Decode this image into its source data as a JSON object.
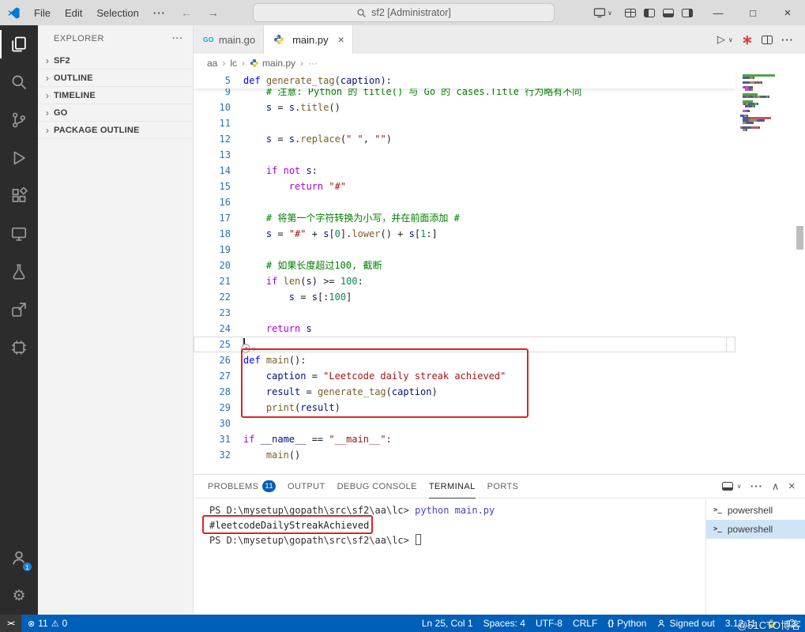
{
  "watermark": "@51CTO博客",
  "titlebar": {
    "menus": [
      "File",
      "Edit",
      "Selection"
    ],
    "more": "···",
    "back": "←",
    "forward": "→",
    "search_text": "sf2 [Administrator]",
    "chevron": "∨",
    "window": {
      "minimize": "—",
      "maximize": "□",
      "close": "×"
    }
  },
  "activity_bar": {
    "account_badge": "1",
    "gear": "⚙"
  },
  "sidebar": {
    "title": "EXPLORER",
    "more": "···",
    "chevron": "›",
    "sections": [
      "SF2",
      "OUTLINE",
      "TIMELINE",
      "GO",
      "PACKAGE OUTLINE"
    ]
  },
  "tabs": {
    "tab1": {
      "label": "main.go",
      "icon_text": "GO"
    },
    "tab2": {
      "label": "main.py",
      "close": "×"
    },
    "actions": {
      "run": "▷",
      "run_chevron": "∨",
      "runner": "∗",
      "more": "···"
    }
  },
  "breadcrumb": {
    "sep": "›",
    "items": [
      "aa",
      "lc",
      "main.py"
    ],
    "more": "···"
  },
  "editor": {
    "cursor_line": 25,
    "hint_chevron": "∨",
    "sticky": {
      "num": 5,
      "ind": 0,
      "tk": [
        [
          "k",
          "def"
        ],
        [
          "o",
          " "
        ],
        [
          "f",
          "generate_tag"
        ],
        [
          "o",
          "("
        ],
        [
          "v",
          "caption"
        ],
        [
          "o",
          "):"
        ]
      ]
    },
    "lines": [
      {
        "num": 9,
        "ind": 4,
        "tk": [
          [
            "c",
            "# 注意: Python 的 title() 与 Go 的 cases.Title 行为略有不同"
          ]
        ]
      },
      {
        "num": 10,
        "ind": 4,
        "tk": [
          [
            "v",
            "s"
          ],
          [
            "o",
            " = "
          ],
          [
            "v",
            "s"
          ],
          [
            "o",
            "."
          ],
          [
            "f",
            "title"
          ],
          [
            "o",
            "()"
          ]
        ]
      },
      {
        "num": 11,
        "ind": 0,
        "tk": []
      },
      {
        "num": 12,
        "ind": 4,
        "tk": [
          [
            "v",
            "s"
          ],
          [
            "o",
            " = "
          ],
          [
            "v",
            "s"
          ],
          [
            "o",
            "."
          ],
          [
            "f",
            "replace"
          ],
          [
            "o",
            "("
          ],
          [
            "s",
            "\" \""
          ],
          [
            "o",
            ", "
          ],
          [
            "s",
            "\"\""
          ],
          [
            "o",
            ")"
          ]
        ]
      },
      {
        "num": 13,
        "ind": 0,
        "tk": []
      },
      {
        "num": 14,
        "ind": 4,
        "tk": [
          [
            "q",
            "if"
          ],
          [
            "o",
            " "
          ],
          [
            "q",
            "not"
          ],
          [
            "o",
            " "
          ],
          [
            "v",
            "s"
          ],
          [
            "o",
            ":"
          ]
        ]
      },
      {
        "num": 15,
        "ind": 8,
        "tk": [
          [
            "q",
            "return"
          ],
          [
            "o",
            " "
          ],
          [
            "s",
            "\"#\""
          ]
        ]
      },
      {
        "num": 16,
        "ind": 0,
        "tk": []
      },
      {
        "num": 17,
        "ind": 4,
        "tk": [
          [
            "c",
            "# 将第一个字符转换为小写，并在前面添加 #"
          ]
        ]
      },
      {
        "num": 18,
        "ind": 4,
        "tk": [
          [
            "v",
            "s"
          ],
          [
            "o",
            " = "
          ],
          [
            "s",
            "\"#\""
          ],
          [
            "o",
            " + "
          ],
          [
            "v",
            "s"
          ],
          [
            "o",
            "["
          ],
          [
            "n",
            "0"
          ],
          [
            "o",
            "]."
          ],
          [
            "f",
            "lower"
          ],
          [
            "o",
            "() + "
          ],
          [
            "v",
            "s"
          ],
          [
            "o",
            "["
          ],
          [
            "n",
            "1"
          ],
          [
            "o",
            ":]"
          ]
        ]
      },
      {
        "num": 19,
        "ind": 0,
        "tk": []
      },
      {
        "num": 20,
        "ind": 4,
        "tk": [
          [
            "c",
            "# 如果长度超过100, 截断"
          ]
        ]
      },
      {
        "num": 21,
        "ind": 4,
        "tk": [
          [
            "q",
            "if"
          ],
          [
            "o",
            " "
          ],
          [
            "f",
            "len"
          ],
          [
            "o",
            "("
          ],
          [
            "v",
            "s"
          ],
          [
            "o",
            ") >= "
          ],
          [
            "n",
            "100"
          ],
          [
            "o",
            ":"
          ]
        ]
      },
      {
        "num": 22,
        "ind": 8,
        "tk": [
          [
            "v",
            "s"
          ],
          [
            "o",
            " = "
          ],
          [
            "v",
            "s"
          ],
          [
            "o",
            "[:"
          ],
          [
            "n",
            "100"
          ],
          [
            "o",
            "]"
          ]
        ]
      },
      {
        "num": 23,
        "ind": 0,
        "tk": []
      },
      {
        "num": 24,
        "ind": 4,
        "tk": [
          [
            "q",
            "return"
          ],
          [
            "o",
            " "
          ],
          [
            "v",
            "s"
          ]
        ]
      },
      {
        "num": 25,
        "ind": 0,
        "tk": []
      },
      {
        "num": 26,
        "ind": 0,
        "tk": [
          [
            "k",
            "def"
          ],
          [
            "o",
            " "
          ],
          [
            "f",
            "main"
          ],
          [
            "o",
            "():"
          ]
        ]
      },
      {
        "num": 27,
        "ind": 4,
        "tk": [
          [
            "v",
            "caption"
          ],
          [
            "o",
            " = "
          ],
          [
            "s",
            "\"Leetcode daily streak achieved\""
          ]
        ]
      },
      {
        "num": 28,
        "ind": 4,
        "tk": [
          [
            "v",
            "result"
          ],
          [
            "o",
            " = "
          ],
          [
            "f",
            "generate_tag"
          ],
          [
            "o",
            "("
          ],
          [
            "v",
            "caption"
          ],
          [
            "o",
            ")"
          ]
        ]
      },
      {
        "num": 29,
        "ind": 4,
        "tk": [
          [
            "f",
            "print"
          ],
          [
            "o",
            "("
          ],
          [
            "v",
            "result"
          ],
          [
            "o",
            ")"
          ]
        ]
      },
      {
        "num": 30,
        "ind": 0,
        "tk": []
      },
      {
        "num": 31,
        "ind": 0,
        "tk": [
          [
            "q",
            "if"
          ],
          [
            "o",
            " "
          ],
          [
            "v",
            "__name__"
          ],
          [
            "o",
            " == "
          ],
          [
            "s",
            "\"__main__\""
          ],
          [
            "o",
            ":"
          ]
        ]
      },
      {
        "num": 32,
        "ind": 4,
        "tk": [
          [
            "f",
            "main"
          ],
          [
            "o",
            "()"
          ]
        ]
      }
    ]
  },
  "panel": {
    "tabs": [
      {
        "label": "PROBLEMS",
        "badge": "11"
      },
      {
        "label": "OUTPUT"
      },
      {
        "label": "DEBUG CONSOLE"
      },
      {
        "label": "TERMINAL"
      },
      {
        "label": "PORTS"
      }
    ],
    "actions": {
      "chevron": "∨",
      "more": "···",
      "maximize": "∧",
      "close": "×"
    },
    "terminal": {
      "icon": ">_",
      "lines": [
        {
          "spans": [
            [
              "prompt",
              "PS D:\\mysetup\\gopath\\src\\sf2\\aa\\lc> "
            ],
            [
              "cmd",
              "python main.py"
            ]
          ]
        },
        {
          "spans": [
            [
              "out",
              "#leetcodeDailyStreakAchieved"
            ]
          ]
        },
        {
          "spans": [
            [
              "prompt",
              "PS D:\\mysetup\\gopath\\src\\sf2\\aa\\lc> "
            ]
          ],
          "cursor": true
        }
      ],
      "list": [
        {
          "label": "powershell"
        },
        {
          "label": "powershell"
        }
      ]
    }
  },
  "status_bar": {
    "remote": "><",
    "error_icon": "⊗",
    "errors": "11",
    "warning_icon": "⚠",
    "warnings": "0",
    "items": {
      "line_col": "Ln 25, Col 1",
      "spaces": "Spaces: 4",
      "encoding": "UTF-8",
      "eol": "CRLF",
      "lang_icon": "{}",
      "language": "Python",
      "signed": "Signed out",
      "version": "3.12.11"
    }
  }
}
